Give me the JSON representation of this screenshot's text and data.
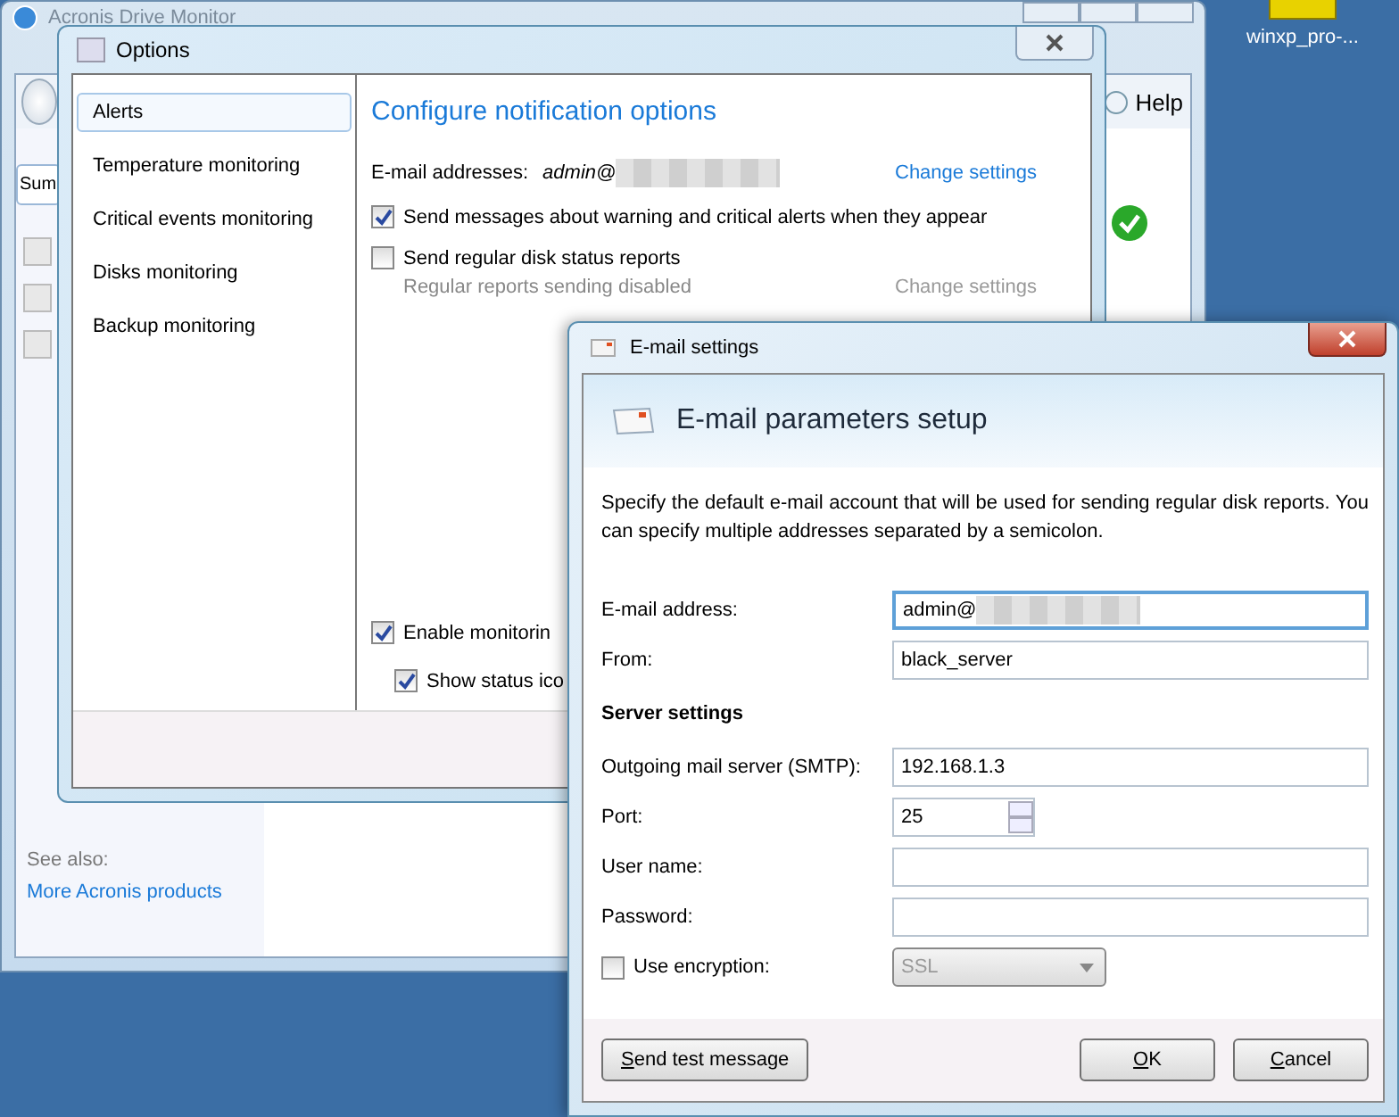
{
  "desktop": {
    "icons": [
      {
        "label": "winxp_pro-..."
      }
    ]
  },
  "main_window": {
    "title": "Acronis Drive Monitor",
    "tab": "Sum",
    "help": "Help",
    "see_also": "See also:",
    "link": "More Acronis products"
  },
  "options_window": {
    "title": "Options",
    "nav": [
      {
        "label": "Alerts",
        "selected": true
      },
      {
        "label": "Temperature monitoring",
        "selected": false
      },
      {
        "label": "Critical events monitoring",
        "selected": false
      },
      {
        "label": "Disks monitoring",
        "selected": false
      },
      {
        "label": "Backup monitoring",
        "selected": false
      }
    ],
    "heading": "Configure notification options",
    "email_label": "E-mail addresses:",
    "email_value": "admin@",
    "email_link": "Change settings",
    "checks": [
      {
        "label": "Send messages about warning and critical alerts when they appear",
        "checked": true
      },
      {
        "label": "Send regular disk status reports",
        "checked": false
      }
    ],
    "reports_status": "Regular reports sending disabled",
    "reports_link": {
      "label": "Change settings",
      "disabled": true
    },
    "monitoring": [
      {
        "label": "Enable monitorin",
        "checked": true,
        "children": [
          {
            "label": "Show status ico",
            "checked": true
          }
        ]
      }
    ]
  },
  "email_dialog": {
    "title": "E-mail settings",
    "heading": "E-mail parameters setup",
    "description": "Specify the default e-mail account that will be used for sending regular disk reports. You can specify multiple addresses separated by a semicolon.",
    "fields": [
      {
        "label": "E-mail address:",
        "value": "admin@",
        "kind": "redacted",
        "focused": true
      },
      {
        "label": "From:",
        "value": "black_server",
        "kind": "text"
      }
    ],
    "section": "Server settings",
    "server_fields": [
      {
        "label": "Outgoing mail server (SMTP):",
        "value": "192.168.1.3",
        "kind": "text"
      },
      {
        "label": "Port:",
        "value": "25",
        "kind": "spin"
      },
      {
        "label": "User name:",
        "kind": "text"
      },
      {
        "label": "Password:",
        "kind": "text"
      }
    ],
    "encryption": {
      "label": "Use encryption:",
      "checked": false,
      "value": "SSL",
      "disabled": true
    },
    "buttons": [
      {
        "label": "Send test message",
        "kind": "left"
      },
      {
        "label": "OK",
        "kind": "right"
      },
      {
        "label": "Cancel",
        "kind": "right"
      }
    ]
  }
}
